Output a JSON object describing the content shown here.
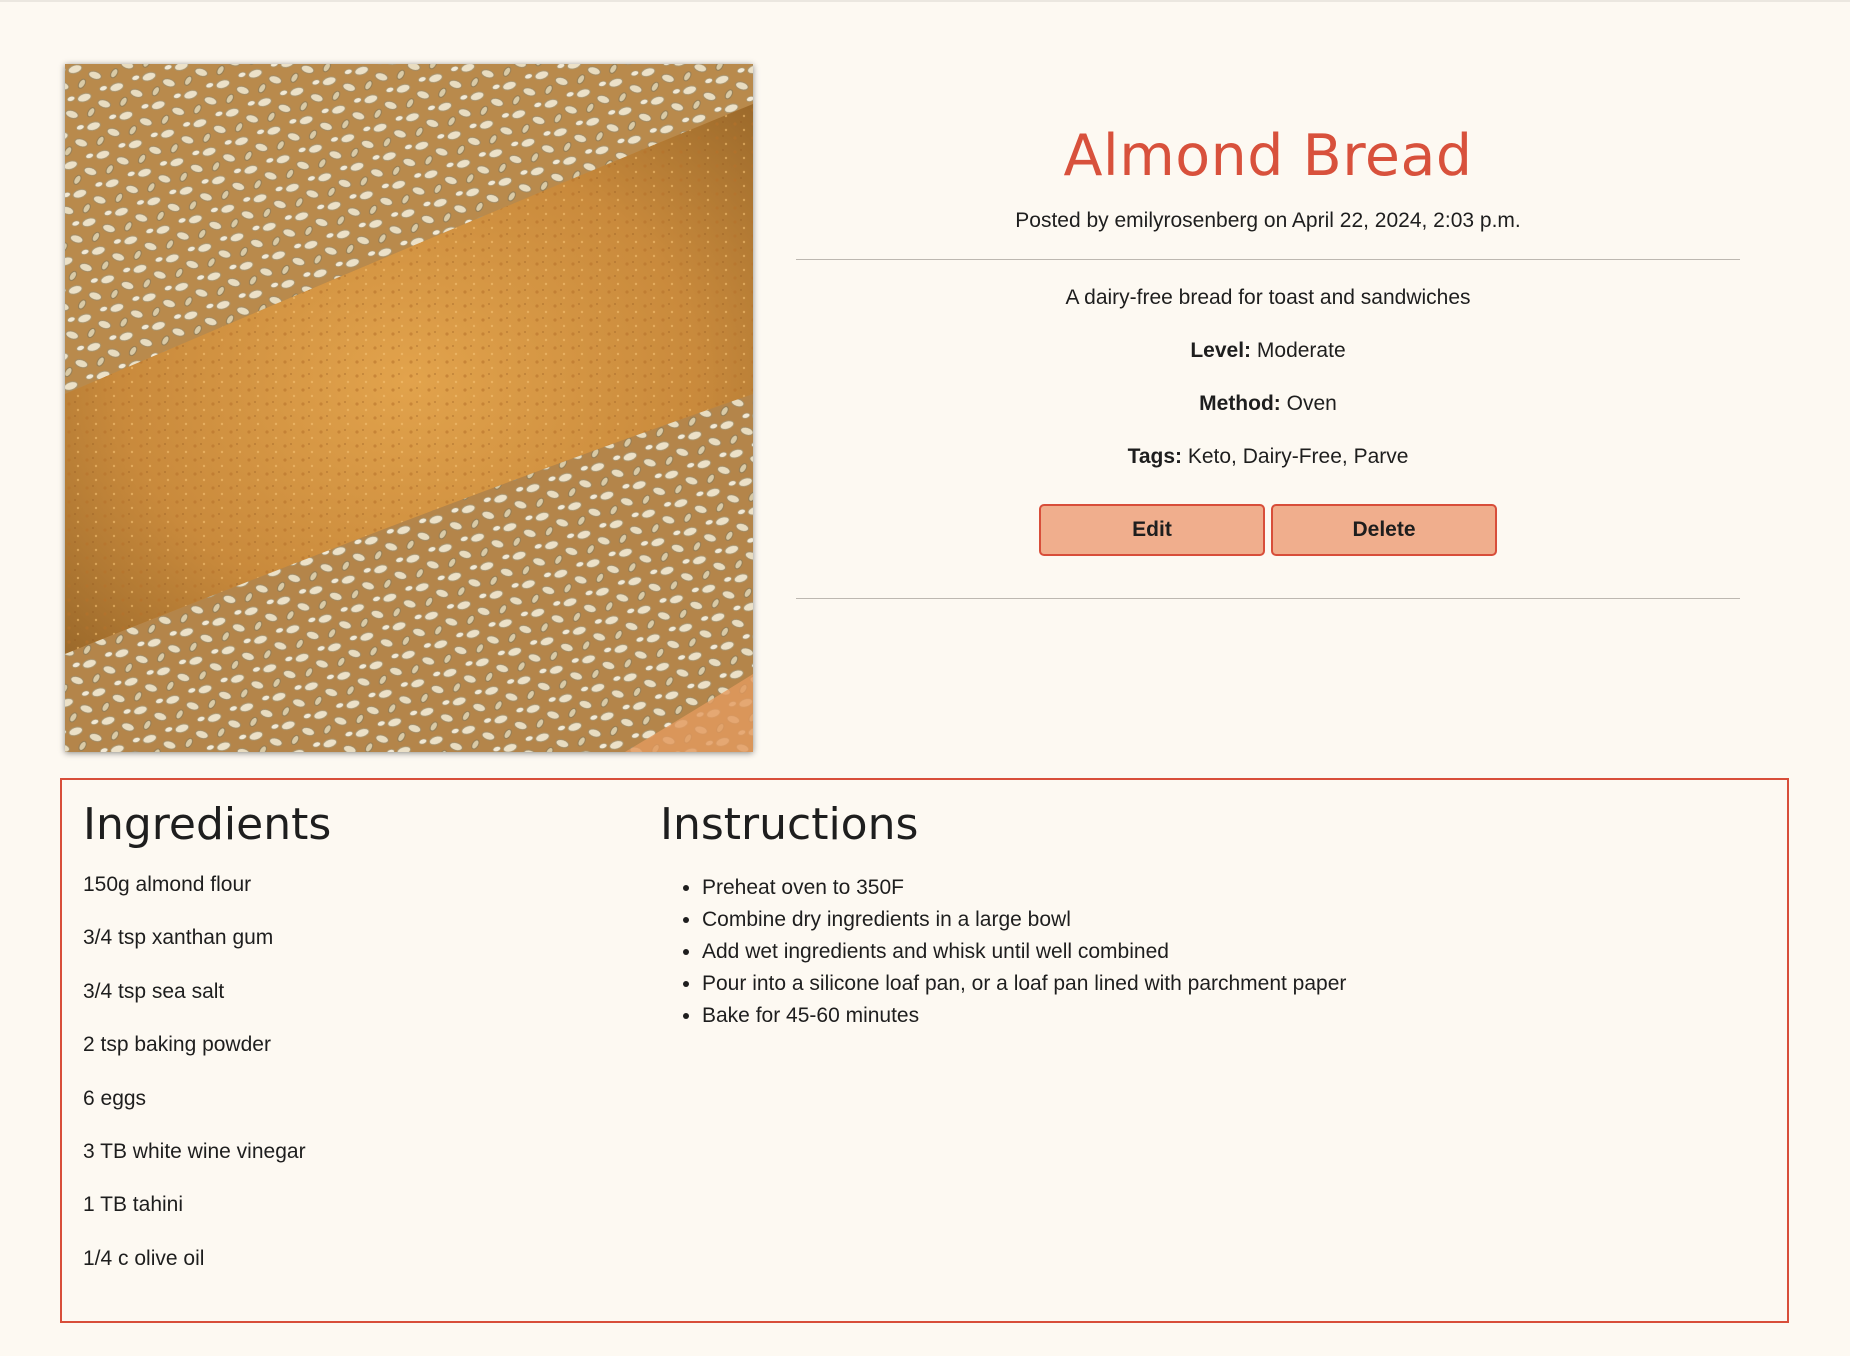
{
  "recipe": {
    "title": "Almond Bread",
    "posted": "Posted by emilyrosenberg on April 22, 2024, 2:03 p.m.",
    "description": "A dairy-free bread for toast and sandwiches",
    "level_label": "Level:",
    "level": "Moderate",
    "method_label": "Method:",
    "method": "Oven",
    "tags_label": "Tags:",
    "tags": "Keto, Dairy-Free, Parve",
    "image_alt": "Almond bread loaf topped with sesame seeds"
  },
  "actions": {
    "edit_label": "Edit",
    "delete_label": "Delete"
  },
  "ingredients": {
    "heading": "Ingredients",
    "items": [
      "150g almond flour",
      "3/4 tsp xanthan gum",
      "3/4 tsp sea salt",
      "2 tsp baking powder",
      "6 eggs",
      "3 TB white wine vinegar",
      "1 TB tahini",
      "1/4 c olive oil"
    ]
  },
  "instructions": {
    "heading": "Instructions",
    "steps": [
      "Preheat oven to 350F",
      "Combine dry ingredients in a large bowl",
      "Add wet ingredients and whisk until well combined",
      "Pour into a silicone loaf pan, or a loaf pan lined with parchment paper",
      "Bake for 45-60 minutes"
    ]
  },
  "colors": {
    "page_background": "#fdf9f2",
    "accent": "#d8513c",
    "button_fill": "#f0ae8d",
    "button_border": "#d84e3a"
  }
}
